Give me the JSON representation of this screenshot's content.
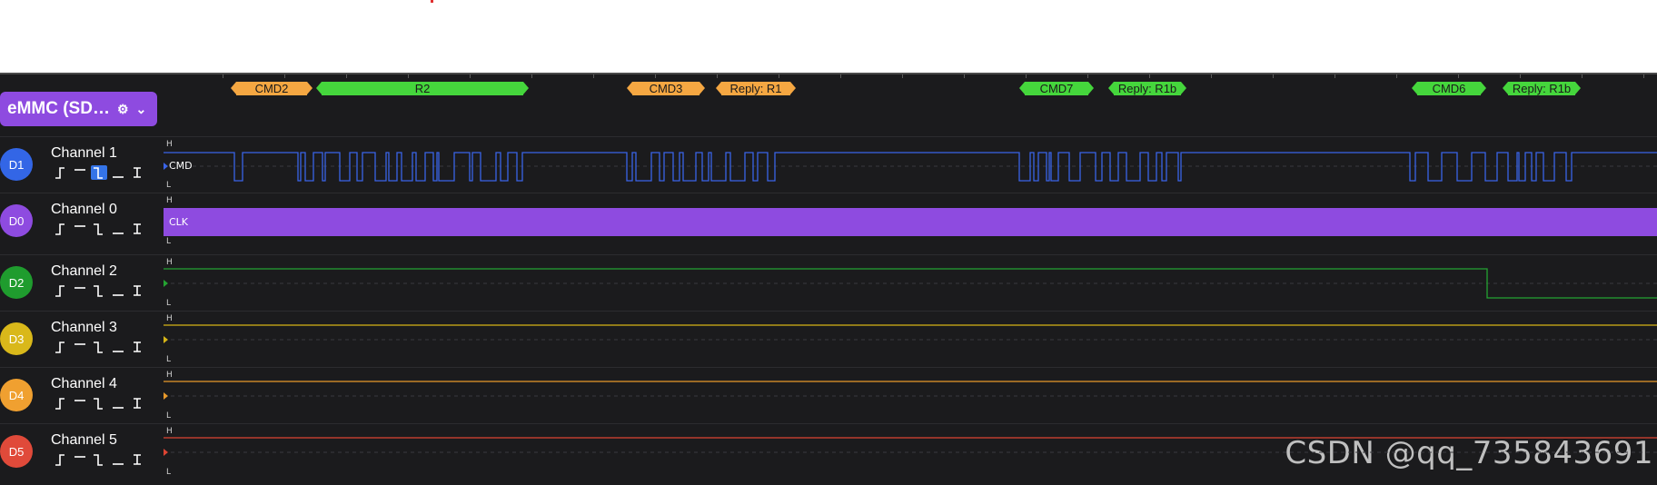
{
  "analyzer": {
    "name": "eMMC (SD…",
    "gear_icon": "gear-icon",
    "chevron_icon": "chevron-down-icon"
  },
  "frames": [
    {
      "label": "CMD2",
      "color": "#f5a742"
    },
    {
      "label": "R2",
      "color": "#45d63c"
    },
    {
      "label": "CMD3",
      "color": "#f5a742"
    },
    {
      "label": "Reply: R1",
      "color": "#f5a742"
    },
    {
      "label": "CMD7",
      "color": "#45d63c"
    },
    {
      "label": "Reply: R1b",
      "color": "#45d63c"
    },
    {
      "label": "CMD6",
      "color": "#45d63c"
    },
    {
      "label": "Reply: R1b",
      "color": "#45d63c"
    }
  ],
  "level_high": "H",
  "level_low": "L",
  "channels": [
    {
      "badge": "D1",
      "name": "Channel 1",
      "color": "#3366e6",
      "signal": "CMD",
      "trace_color": "#3a64e8"
    },
    {
      "badge": "D0",
      "name": "Channel 0",
      "color": "#8e4be0",
      "signal": "CLK",
      "trace_color": "#8e4be0"
    },
    {
      "badge": "D2",
      "name": "Channel 2",
      "color": "#1f9c2e",
      "trace_color": "#24a332"
    },
    {
      "badge": "D3",
      "name": "Channel 3",
      "color": "#d9b81a",
      "trace_color": "#d6b517"
    },
    {
      "badge": "D4",
      "name": "Channel 4",
      "color": "#f0a030",
      "trace_color": "#e8992b"
    },
    {
      "badge": "D5",
      "name": "Channel 5",
      "color": "#e04a3a",
      "trace_color": "#dd4433"
    }
  ],
  "trigger_icons": [
    "rising-edge-trigger-icon",
    "high-level-trigger-icon",
    "falling-edge-trigger-icon",
    "low-level-trigger-icon",
    "any-edge-trigger-icon"
  ],
  "watermark": "CSDN @qq_735843691"
}
